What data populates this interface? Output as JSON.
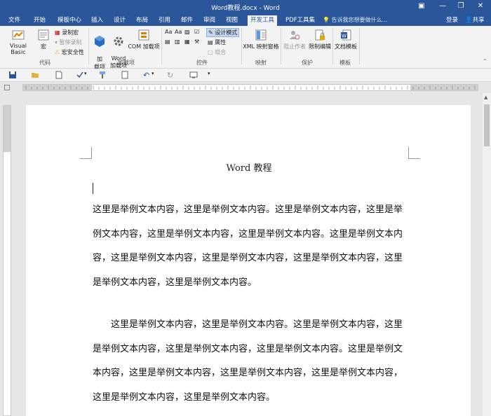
{
  "window": {
    "title": "Word教程.docx - Word"
  },
  "tabs": [
    {
      "label": "文件"
    },
    {
      "label": "开始"
    },
    {
      "label": "模板中心"
    },
    {
      "label": "插入"
    },
    {
      "label": "设计"
    },
    {
      "label": "布局"
    },
    {
      "label": "引用"
    },
    {
      "label": "邮件"
    },
    {
      "label": "审阅"
    },
    {
      "label": "视图"
    },
    {
      "label": "开发工具"
    },
    {
      "label": "PDF工具集"
    }
  ],
  "active_tab": "开发工具",
  "tell_me": "告诉我您想要做什么...",
  "account": {
    "login": "登录",
    "share": "共享"
  },
  "ribbon": {
    "code": {
      "label": "代码",
      "visual_basic": "Visual Basic",
      "macros": "宏",
      "record_macro": "录制宏",
      "pause_recording": "暂停录制",
      "macro_security": "宏安全性"
    },
    "addins": {
      "label": "加载项",
      "addins": "加\n载项",
      "word_addins": "Word\n加载项",
      "com_addins": "COM 加载项"
    },
    "controls": {
      "label": "控件",
      "design_mode": "设计模式",
      "properties": "属性",
      "group": "组合"
    },
    "mapping": {
      "label": "映射",
      "xml_mapping": "XML 映射窗格"
    },
    "protect": {
      "label": "保护",
      "block_authors": "阻止作者",
      "restrict_editing": "限制编辑"
    },
    "templates": {
      "label": "模板",
      "document_template": "文档模板"
    }
  },
  "document": {
    "title": "Word 教程",
    "paragraphs": [
      "这里是举例文本内容，这里是举例文本内容。这里是举例文本内容，这里是举例文本内容，这里是举例文本内容，这里是举例文本内容。这里是举例文本内容，这里是举例文本内容，这里是举例文本内容，这里是举例文本内容，这里是举例文本内容，这里是举例文本内容。",
      "这里是举例文本内容，这里是举例文本内容。这里是举例文本内容，这里是举例文本内容，这里是举例文本内容，这里是举例文本内容。这里是举例文本内容，这里是举例文本内容，这里是举例文本内容，这里是举例文本内容，这里是举例文本内容，这里是举例文本内容。"
    ]
  },
  "colors": {
    "accent": "#2b579a",
    "ribbon_bg": "#f3f3f3",
    "page_bg": "#ffffff"
  }
}
